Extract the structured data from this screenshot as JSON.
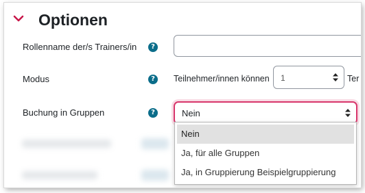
{
  "section": {
    "title": "Optionen",
    "accent_color": "#c8184a"
  },
  "fields": {
    "trainer_role": {
      "label": "Rollenname der/s Trainers/in",
      "value": ""
    },
    "modus": {
      "label": "Modus",
      "prefix_text": "Teilnehmer/innen können",
      "select_value": "1",
      "trailing_text": "Ter"
    },
    "groups": {
      "label": "Buchung in Gruppen",
      "select_value": "Nein",
      "focus_color": "#d8356b",
      "options": [
        "Nein",
        "Ja, für alle Gruppen",
        "Ja, in Gruppierung Beispielgruppierung"
      ]
    }
  },
  "help_icon_glyph": "?"
}
